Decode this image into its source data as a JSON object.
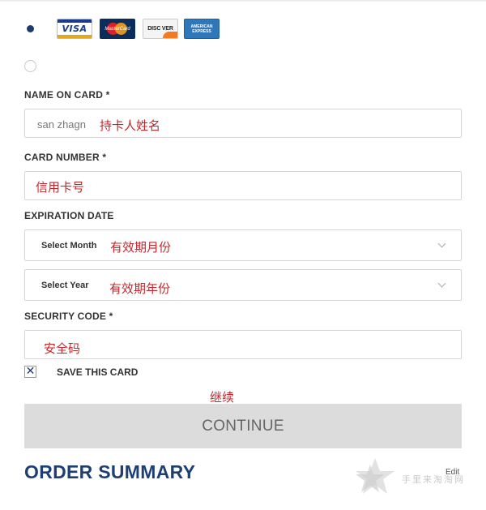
{
  "payment_options": {
    "card_option_selected": true,
    "other_option_selected": false
  },
  "card_logos": {
    "visa": "VISA",
    "mastercard": "MasterCard",
    "discover": "DISC VER",
    "amex_line1": "AMERICAN",
    "amex_line2": "EXPRESS"
  },
  "form": {
    "name_label": "NAME ON CARD *",
    "name_value": "san zhagn",
    "name_note": "持卡人姓名",
    "card_number_label": "CARD NUMBER *",
    "card_number_note": "信用卡号",
    "expiration_label": "EXPIRATION DATE",
    "month_value": "Select Month",
    "month_note": "有效期月份",
    "year_value": "Select Year",
    "year_note": "有效期年份",
    "security_label": "SECURITY CODE *",
    "security_note": "安全码",
    "save_card_checked": true,
    "save_card_mark": "✕",
    "save_card_label": "SAVE THIS CARD",
    "continue_note": "继续",
    "continue_label": "CONTINUE"
  },
  "order_summary": {
    "title": "ORDER SUMMARY",
    "edit_label": "Edit"
  },
  "watermark": {
    "text": "手里来淘淘网"
  },
  "colors": {
    "brand_navy": "#1d3f73",
    "annotation_red": "#c0282d",
    "button_gray": "#dcdcdc"
  }
}
